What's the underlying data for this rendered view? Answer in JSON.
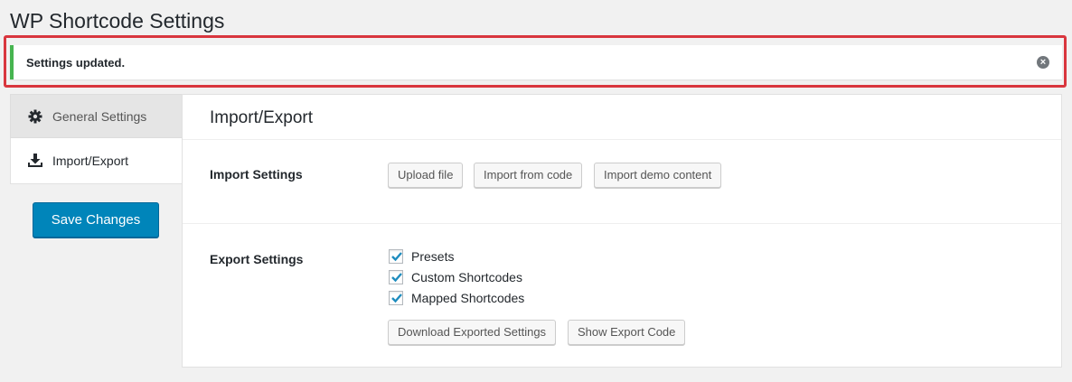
{
  "page": {
    "title": "WP Shortcode Settings"
  },
  "notice": {
    "message": "Settings updated.",
    "dismiss_icon": "close-circle-icon",
    "border_color": "#46b450",
    "highlight_color": "#d9363e"
  },
  "tabs": [
    {
      "label": "General Settings",
      "icon": "gear-icon",
      "active": false
    },
    {
      "label": "Import/Export",
      "icon": "download-icon",
      "active": true
    }
  ],
  "save_button": {
    "label": "Save Changes",
    "color": "#0085ba"
  },
  "panel": {
    "title": "Import/Export",
    "import": {
      "label": "Import Settings",
      "buttons": [
        "Upload file",
        "Import from code",
        "Import demo content"
      ]
    },
    "export": {
      "label": "Export Settings",
      "checkboxes": [
        {
          "label": "Presets",
          "checked": true
        },
        {
          "label": "Custom Shortcodes",
          "checked": true
        },
        {
          "label": "Mapped Shortcodes",
          "checked": true
        }
      ],
      "buttons": [
        "Download Exported Settings",
        "Show Export Code"
      ]
    }
  },
  "checkbox_color": "#1e8cbe"
}
